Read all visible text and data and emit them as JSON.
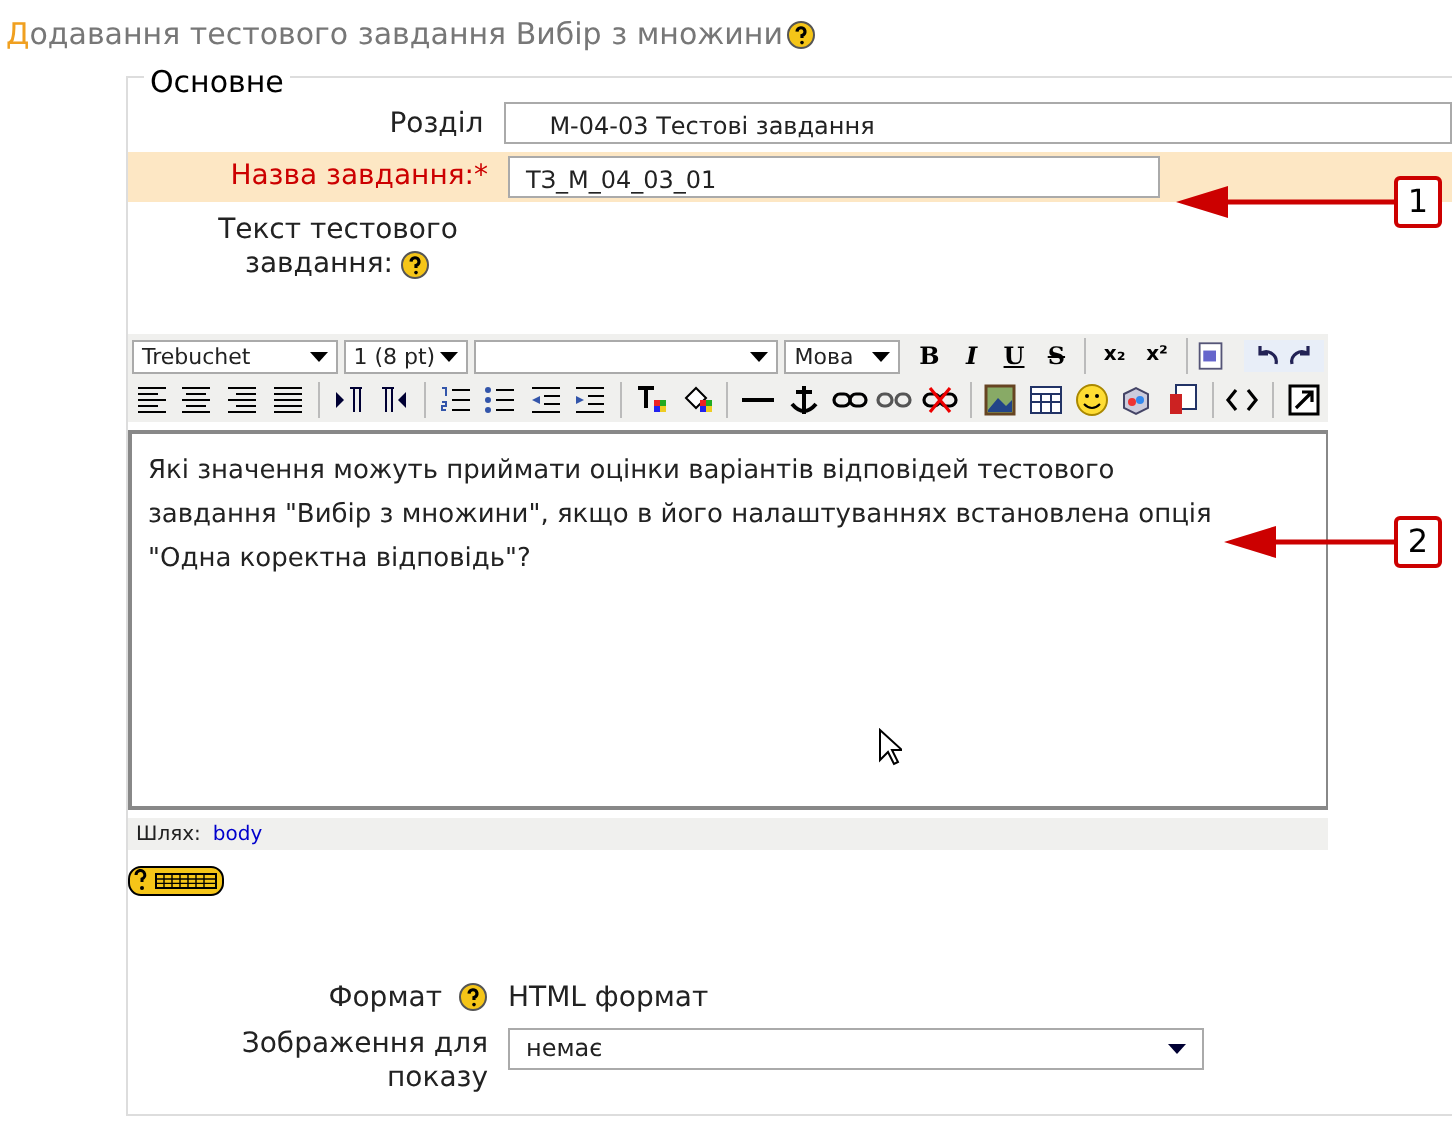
{
  "page_title": "Додавання тестового завдання Вибір з множини",
  "fieldset": {
    "legend": "Основне"
  },
  "section_field": {
    "label": "Розділ",
    "value": "М-04-03 Тестові завдання"
  },
  "name_field": {
    "label": "Назва завдання:",
    "required_mark": "*",
    "value": "ТЗ_М_04_03_01",
    "highlighted": true
  },
  "text_field": {
    "label": "Текст тестового завдання:"
  },
  "editor": {
    "dropdowns": [
      {
        "kind": "font",
        "value": "Trebuchet"
      },
      {
        "kind": "size",
        "value": "1 (8 pt)"
      },
      {
        "kind": "format"
      },
      {
        "kind": "language",
        "value": "Мова"
      }
    ],
    "format_buttons": [
      {
        "label": "B",
        "kind": "bold"
      },
      {
        "label": "I",
        "kind": "italic"
      },
      {
        "label": "U",
        "kind": "underline"
      },
      {
        "label": "S",
        "kind": "strike"
      },
      {
        "label": "x₂",
        "kind": "sub"
      },
      {
        "label": "x²",
        "kind": "sup"
      }
    ],
    "content": "Які значення можуть приймати оцінки варіантів відповідей тестового завдання \"Вибір з множини\", якщо в його налаштуваннях встановлена опція \"Одна коректна відповідь\"?",
    "path_label": "Шлях:",
    "path_link": "body"
  },
  "callouts": [
    {
      "number": "1"
    },
    {
      "number": "2"
    }
  ],
  "format_field": {
    "label": "Формат",
    "value": "HTML формат"
  },
  "image_field": {
    "label": "Зображення для показу",
    "value": "немає"
  }
}
